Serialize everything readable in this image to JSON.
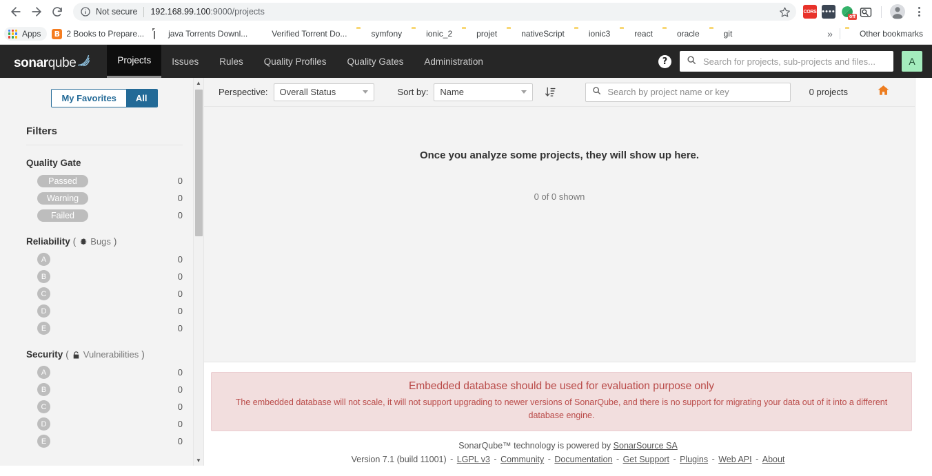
{
  "browser": {
    "back_icon": "back-arrow-icon",
    "forward_icon": "forward-arrow-icon",
    "reload_icon": "reload-icon",
    "security_label": "Not secure",
    "url_host": "192.168.99.100",
    "url_port": ":9000",
    "url_path": "/projects",
    "star_icon": "bookmark-star-icon",
    "extensions": [
      {
        "name": "cors-extension",
        "label": "CORS"
      },
      {
        "name": "dark-extension",
        "label": "••••"
      },
      {
        "name": "adblock-extension",
        "label": "off"
      },
      {
        "name": "screenshot-extension",
        "label": ""
      }
    ],
    "profile_icon": "profile-avatar-icon",
    "menu_icon": "chrome-menu-icon"
  },
  "bookmarks": {
    "apps_label": "Apps",
    "items": [
      {
        "label": "2 Books to Prepare...",
        "icon": "blogger-icon"
      },
      {
        "label": "java Torrents Downl...",
        "icon": "document-icon"
      },
      {
        "label": "Verified Torrent Do...",
        "icon": "green-globe-icon"
      },
      {
        "label": "symfony",
        "icon": "folder-icon"
      },
      {
        "label": "ionic_2",
        "icon": "folder-icon"
      },
      {
        "label": "projet",
        "icon": "folder-icon"
      },
      {
        "label": "nativeScript",
        "icon": "folder-icon"
      },
      {
        "label": "ionic3",
        "icon": "folder-icon"
      },
      {
        "label": "react",
        "icon": "folder-icon"
      },
      {
        "label": "oracle",
        "icon": "folder-icon"
      },
      {
        "label": "git",
        "icon": "folder-icon"
      }
    ],
    "overflow_label": "»",
    "other_label": "Other bookmarks"
  },
  "header": {
    "logo_bold": "sonar",
    "logo_light": "qube",
    "nav": [
      {
        "label": "Projects",
        "active": true
      },
      {
        "label": "Issues",
        "active": false
      },
      {
        "label": "Rules",
        "active": false
      },
      {
        "label": "Quality Profiles",
        "active": false
      },
      {
        "label": "Quality Gates",
        "active": false
      },
      {
        "label": "Administration",
        "active": false
      }
    ],
    "help_label": "?",
    "search_placeholder": "Search for projects, sub-projects and files...",
    "search_value": "",
    "avatar_letter": "A",
    "avatar_color": "#a4ecbd",
    "bar_color": "#262626"
  },
  "sidebar": {
    "toggle": {
      "favorites_label": "My Favorites",
      "all_label": "All",
      "active": "All"
    },
    "filters_title": "Filters",
    "facets": [
      {
        "name": "quality-gate",
        "title": "Quality Gate",
        "hint": "",
        "icon": "",
        "type": "pill",
        "rows": [
          {
            "label": "Passed",
            "value": "0"
          },
          {
            "label": "Warning",
            "value": "0"
          },
          {
            "label": "Failed",
            "value": "0"
          }
        ]
      },
      {
        "name": "reliability",
        "title": "Reliability",
        "hint": "Bugs",
        "icon": "bug-icon",
        "type": "rating",
        "rows": [
          {
            "label": "A",
            "value": "0"
          },
          {
            "label": "B",
            "value": "0"
          },
          {
            "label": "C",
            "value": "0"
          },
          {
            "label": "D",
            "value": "0"
          },
          {
            "label": "E",
            "value": "0"
          }
        ]
      },
      {
        "name": "security",
        "title": "Security",
        "hint": "Vulnerabilities",
        "icon": "open-lock-icon",
        "type": "rating",
        "rows": [
          {
            "label": "A",
            "value": "0"
          },
          {
            "label": "B",
            "value": "0"
          },
          {
            "label": "C",
            "value": "0"
          },
          {
            "label": "D",
            "value": "0"
          },
          {
            "label": "E",
            "value": "0"
          }
        ]
      }
    ]
  },
  "toolbar": {
    "perspective_label": "Perspective:",
    "perspective_value": "Overall Status",
    "sort_label": "Sort by:",
    "sort_value": "Name",
    "sort_direction_icon": "sort-ascending-icon",
    "project_search_placeholder": "Search by project name or key",
    "project_search_value": "",
    "project_count": "0 projects",
    "home_icon": "home-icon",
    "home_color": "#ed7d20"
  },
  "main": {
    "empty_title": "Once you analyze some projects, they will show up here.",
    "empty_sub": "0 of 0 shown"
  },
  "warning": {
    "title": "Embedded database should be used for evaluation purpose only",
    "text": "The embedded database will not scale, it will not support upgrading to newer versions of SonarQube, and there is no support for migrating your data out of it into a different database engine.",
    "bg_color": "#f2dede",
    "text_color": "#b94a48"
  },
  "footer": {
    "line1_prefix": "SonarQube™ technology is powered by ",
    "line1_link": "SonarSource SA",
    "version": "Version 7.1 (build 11001)",
    "links": [
      "LGPL v3",
      "Community",
      "Documentation",
      "Get Support",
      "Plugins",
      "Web API",
      "About"
    ]
  }
}
